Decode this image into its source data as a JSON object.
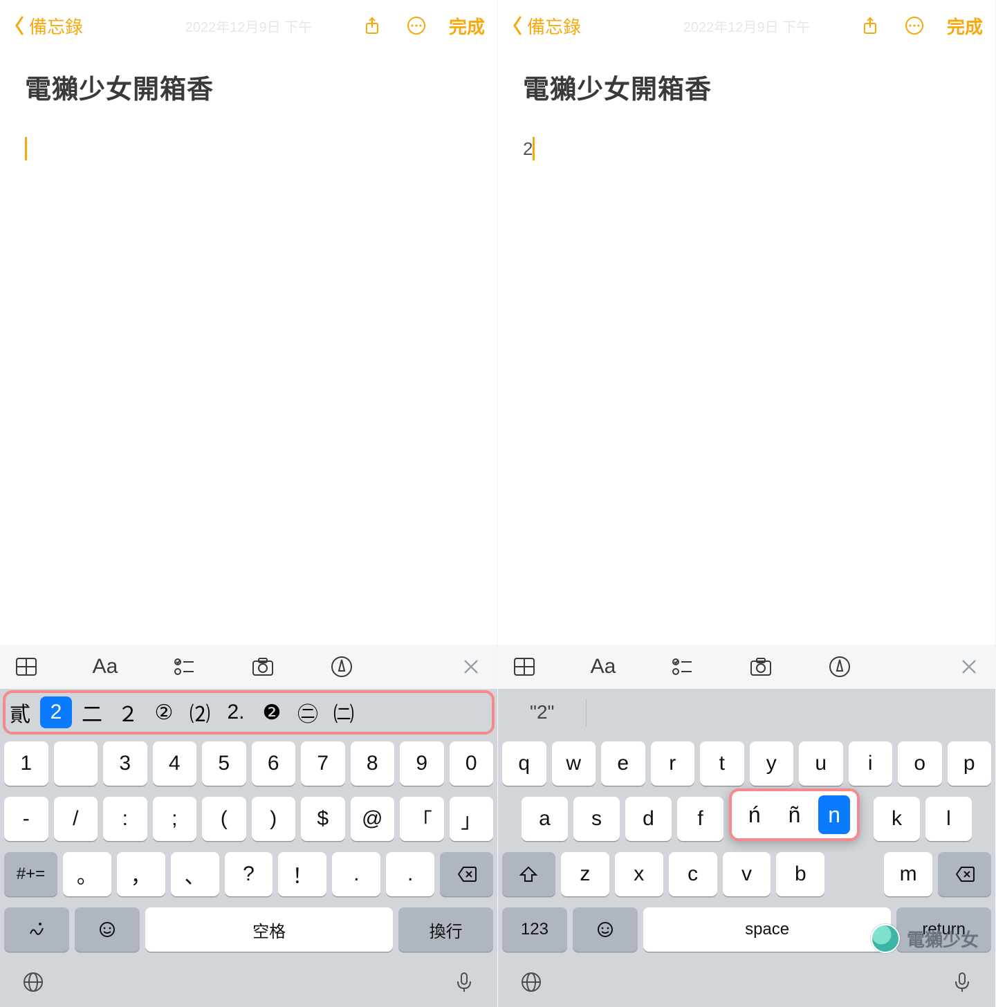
{
  "left": {
    "nav": {
      "back_label": "備忘錄",
      "done_label": "完成",
      "date_faint": "2022年12月9日 下午"
    },
    "note": {
      "title": "電獺少女開箱香",
      "body_text": ""
    },
    "toolbar": {
      "aa_label": "Aa"
    },
    "candidates": [
      "貳",
      "2",
      "二",
      "２",
      "②",
      "⑵",
      "2.",
      "❷",
      "㊁",
      "㈡"
    ],
    "candidates_selected_index": 1,
    "keys_row1": [
      "1",
      "",
      "3",
      "4",
      "5",
      "6",
      "7",
      "8",
      "9",
      "0"
    ],
    "keys_row2": [
      "-",
      "/",
      ":",
      ";",
      "(",
      ")",
      "$",
      "@",
      "「",
      "」"
    ],
    "keys_row3_mode": "#+=",
    "keys_row3": [
      "。",
      "，",
      "、",
      "?",
      "！",
      ".",
      "."
    ],
    "keys_row4": {
      "space": "空格",
      "return": "換行"
    }
  },
  "right": {
    "nav": {
      "back_label": "備忘錄",
      "done_label": "完成",
      "date_faint": "2022年12月9日 下午"
    },
    "note": {
      "title": "電獺少女開箱香",
      "body_text": "2"
    },
    "toolbar": {
      "aa_label": "Aa"
    },
    "candidate_quoted": "\"2\"",
    "keys_row1": [
      "q",
      "w",
      "e",
      "r",
      "t",
      "y",
      "u",
      "i",
      "o",
      "p"
    ],
    "keys_row2": [
      "a",
      "s",
      "d",
      "f",
      "",
      "",
      "",
      "k",
      "l"
    ],
    "n_popup_options": [
      "ń",
      "ñ",
      "n"
    ],
    "n_popup_selected_index": 2,
    "keys_row3": [
      "z",
      "x",
      "c",
      "v",
      "b",
      "",
      "m"
    ],
    "keys_row4": {
      "mode": "123",
      "space": "space",
      "return": "return"
    }
  },
  "watermark_text": "電獺少女"
}
